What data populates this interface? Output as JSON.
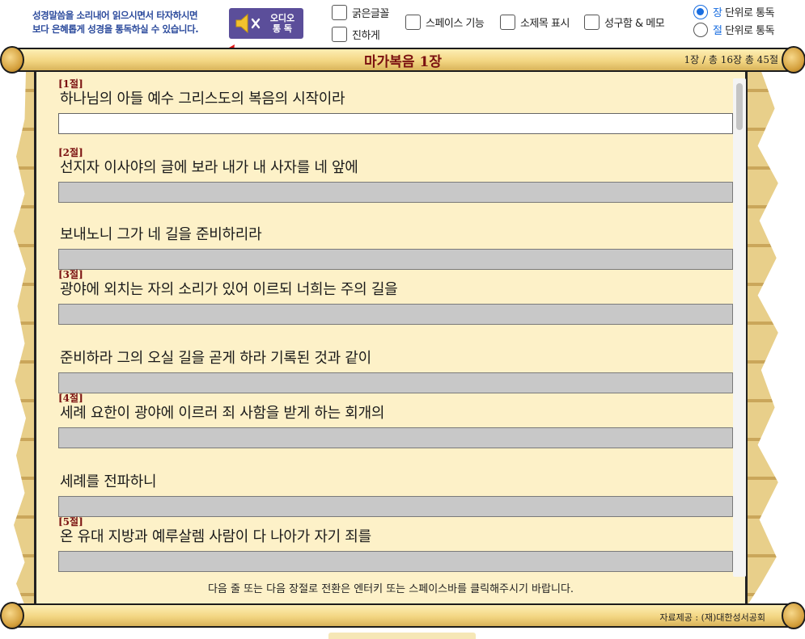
{
  "promo": {
    "line1": "성경말씀을 소리내어 읽으시면서 타자하시면",
    "line2": "보다 은혜롭게 성경을 통독하실 수 있습니다."
  },
  "audio_button": {
    "line1": "오디오",
    "line2": "통  독",
    "icon": "speaker-muted-icon",
    "color": "#5b4e9a"
  },
  "options": {
    "bold_font": "굵은글꼴",
    "darker": "진하게",
    "space_function": "스페이스 기능",
    "show_subtitle": "소제목 표시",
    "verse_memo": "성구함 & 메모"
  },
  "reading_mode": {
    "chapter_prefix": "장",
    "chapter_suffix": " 단위로 통독",
    "verse_prefix": "절",
    "verse_suffix": " 단위로 통독",
    "selected": "chapter"
  },
  "header": {
    "book_chapter": "마가복음 1장",
    "count": "1장 / 총 16장   총 45절"
  },
  "verses": [
    {
      "num": "[1절]",
      "text": "하나님의 아들 예수 그리스도의 복음의 시작이라",
      "active": true
    },
    {
      "num": "[2절]",
      "text": "선지자 이사야의 글에 보라 내가 내 사자를 네 앞에"
    },
    {
      "num": "",
      "text": "보내노니 그가 네 길을 준비하리라"
    },
    {
      "num": "[3절]",
      "text": "광야에 외치는 자의 소리가 있어 이르되 너희는 주의 길을"
    },
    {
      "num": "",
      "text": "준비하라 그의 오실 길을 곧게 하라 기록된 것과 같이"
    },
    {
      "num": "[4절]",
      "text": "세례 요한이 광야에 이르러 죄 사함을 받게 하는 회개의"
    },
    {
      "num": "",
      "text": "세례를 전파하니"
    },
    {
      "num": "[5절]",
      "text": "온 유대 지방과 예루살렘 사람이 다 나아가 자기 죄를"
    }
  ],
  "hint": "다음 줄 또는 다음 장절로 전환은 엔터키 또는 스페이스바를 클릭해주시기 바랍니다.",
  "credit": "자료제공 : (재)대한성서공회",
  "colors": {
    "accent": "#1a6ee0",
    "verse_label": "#7a1010",
    "paper": "#fdf1c8"
  }
}
